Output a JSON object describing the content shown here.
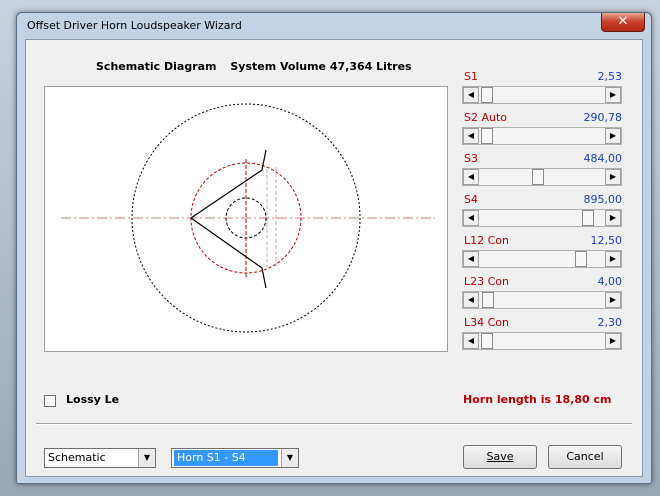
{
  "window": {
    "title": "Offset Driver Horn Loudspeaker Wizard",
    "close_label": "✕"
  },
  "heading": {
    "left": "Schematic Diagram",
    "right": "System Volume 47,364 Litres"
  },
  "params": [
    {
      "label": "S1",
      "value": "2,53",
      "level": 0.02
    },
    {
      "label": "S2 Auto",
      "value": "290,78",
      "level": 0.02
    },
    {
      "label": "S3",
      "value": "484,00",
      "level": 0.46
    },
    {
      "label": "S4",
      "value": "895,00",
      "level": 0.89
    },
    {
      "label": "L12 Con",
      "value": "12,50",
      "level": 0.83
    },
    {
      "label": "L23 Con",
      "value": "4,00",
      "level": 0.03
    },
    {
      "label": "L34 Con",
      "value": "2,30",
      "level": 0.02
    }
  ],
  "lossy": {
    "label": "Lossy Le",
    "checked": false
  },
  "horn_length": "Horn length is 18,80 cm",
  "view_combo": {
    "value": "Schematic"
  },
  "horn_combo": {
    "value": "Horn S1 - S4"
  },
  "buttons": {
    "save": "Save",
    "cancel": "Cancel"
  },
  "colors": {
    "label_red": "#c00000",
    "value_blue": "#1a3fc0",
    "selection": "#3399ff"
  }
}
